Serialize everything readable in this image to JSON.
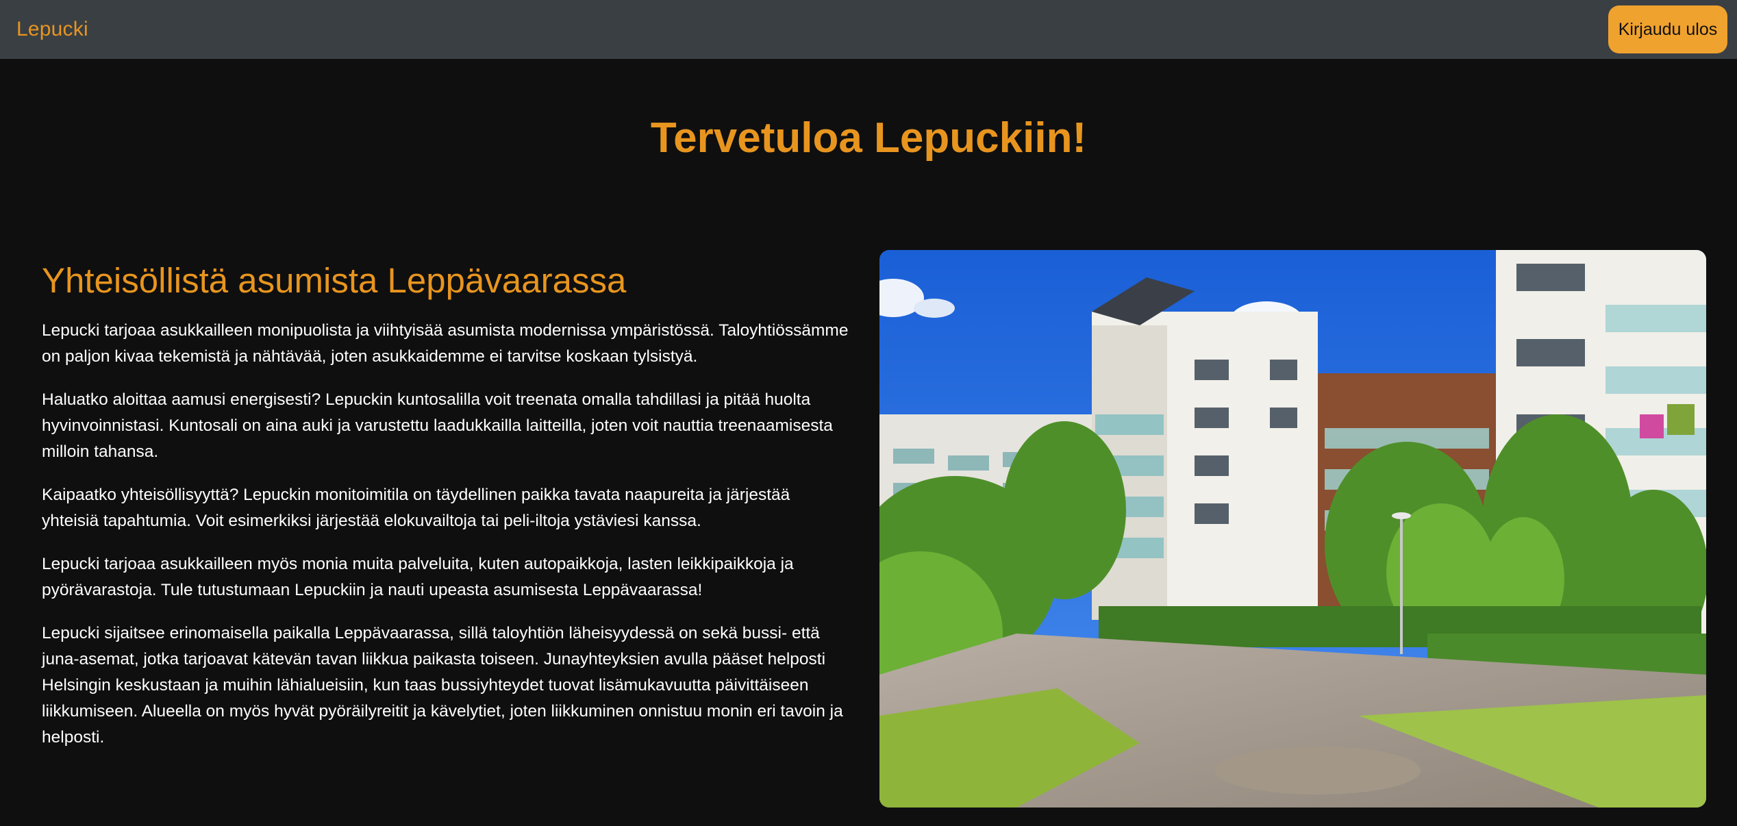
{
  "navbar": {
    "brand": "Lepucki",
    "logout_label": "Kirjaudu ulos"
  },
  "main": {
    "title": "Tervetuloa Lepuckiin!",
    "section_heading": "Yhteisöllistä asumista Leppävaarassa",
    "paragraphs": [
      "Lepucki tarjoaa asukkailleen monipuolista ja viihtyisää asumista modernissa ympäristössä. Taloyhtiössämme on paljon kivaa tekemistä ja nähtävää, joten asukkaidemme ei tarvitse koskaan tylsistyä.",
      "Haluatko aloittaa aamusi energisesti? Lepuckin kuntosalilla voit treenata omalla tahdillasi ja pitää huolta hyvinvoinnistasi. Kuntosali on aina auki ja varustettu laadukkailla laitteilla, joten voit nauttia treenaamisesta milloin tahansa.",
      "Kaipaatko yhteisöllisyyttä? Lepuckin monitoimitila on täydellinen paikka tavata naapureita ja järjestää yhteisiä tapahtumia. Voit esimerkiksi järjestää elokuvailtoja tai peli-iltoja ystäviesi kanssa.",
      "Lepucki tarjoaa asukkailleen myös monia muita palveluita, kuten autopaikkoja, lasten leikkipaikkoja ja pyörävarastoja. Tule tutustumaan Lepuckiin ja nauti upeasta asumisesta Leppävaarassa!",
      "Lepucki sijaitsee erinomaisella paikalla Leppävaarassa, sillä taloyhtiön läheisyydessä on sekä bussi- että juna-asemat, jotka tarjoavat kätevän tavan liikkua paikasta toiseen. Junayhteyksien avulla pääset helposti Helsingin keskustaan ja muihin lähialueisiin, kun taas bussiyhteydet tuovat lisämukavuutta päivittäiseen liikkumiseen. Alueella on myös hyvät pyöräilyreitit ja kävelytiet, joten liikkuminen onnistuu monin eri tavoin ja helposti."
    ]
  },
  "colors": {
    "accent": "#e8951f",
    "button": "#f0a22e",
    "navbar_bg": "#3a3f44",
    "page_bg": "#0f0f0f"
  }
}
